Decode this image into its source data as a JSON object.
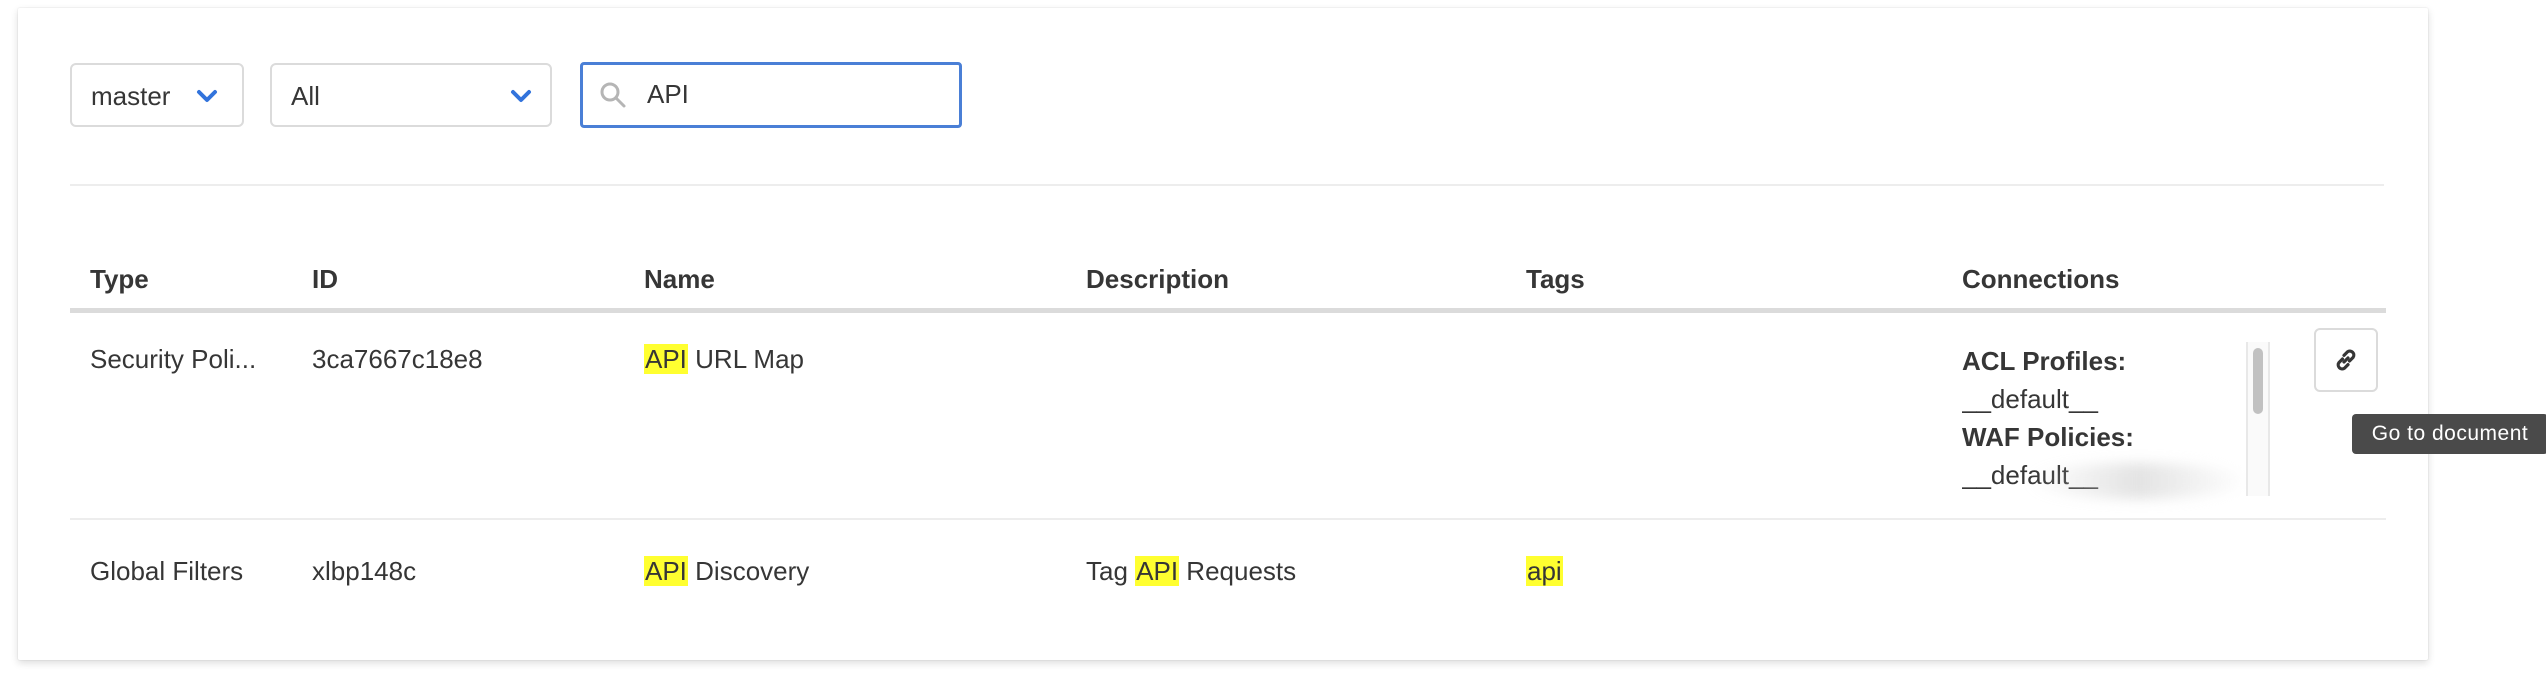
{
  "filters": {
    "branch": "master",
    "doc_type": "All",
    "search_value": "API",
    "search_icon": "search-icon",
    "chevron_icon": "chevron-down-icon"
  },
  "table": {
    "headers": [
      "Type",
      "ID",
      "Name",
      "Description",
      "Tags",
      "Connections"
    ],
    "rows": [
      {
        "type": "Security Poli...",
        "id": "3ca7667c18e8",
        "name_highlight": "API",
        "name_rest": " URL Map",
        "description_pre": "",
        "description_highlight": "",
        "description_rest": "",
        "tags": "",
        "connections": [
          {
            "label": "ACL Profiles:",
            "value": "__default__"
          },
          {
            "label": "WAF Policies:",
            "value": "__default__"
          }
        ]
      },
      {
        "type": "Global Filters",
        "id": "xlbp148c",
        "name_highlight": "API",
        "name_rest": " Discovery",
        "description_pre": "Tag ",
        "description_highlight": "API",
        "description_rest": " Requests",
        "tags": "api"
      }
    ]
  },
  "actions": {
    "go_to_document_icon": "link-icon",
    "tooltip": "Go to document"
  },
  "colors": {
    "highlight": "#ffff30",
    "accent": "#4a7fd6",
    "chevron": "#3273dc",
    "tooltip_bg": "#4a4a4a"
  }
}
